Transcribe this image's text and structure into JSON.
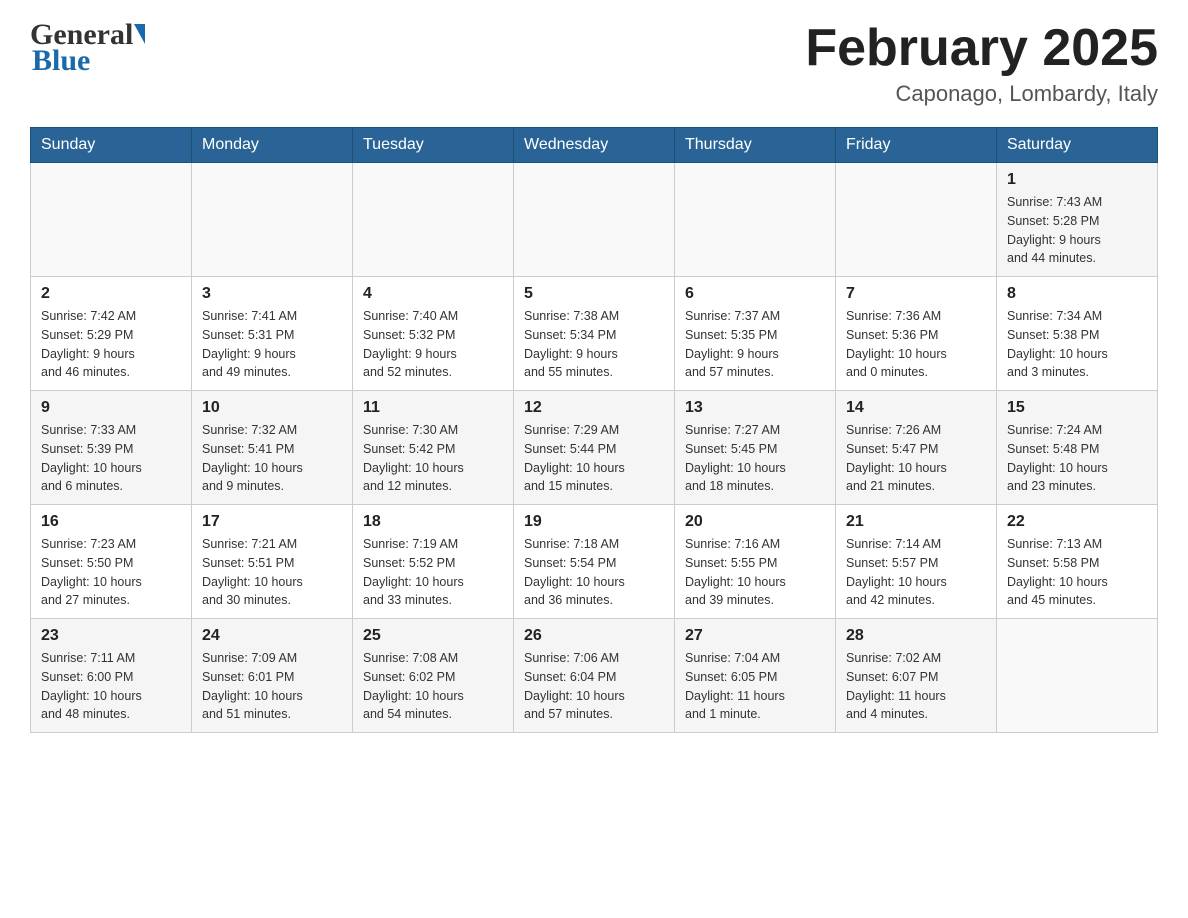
{
  "header": {
    "logo_general": "General",
    "logo_blue": "Blue",
    "month_title": "February 2025",
    "location": "Caponago, Lombardy, Italy"
  },
  "days_of_week": [
    "Sunday",
    "Monday",
    "Tuesday",
    "Wednesday",
    "Thursday",
    "Friday",
    "Saturday"
  ],
  "weeks": [
    [
      {
        "day": "",
        "info": ""
      },
      {
        "day": "",
        "info": ""
      },
      {
        "day": "",
        "info": ""
      },
      {
        "day": "",
        "info": ""
      },
      {
        "day": "",
        "info": ""
      },
      {
        "day": "",
        "info": ""
      },
      {
        "day": "1",
        "info": "Sunrise: 7:43 AM\nSunset: 5:28 PM\nDaylight: 9 hours\nand 44 minutes."
      }
    ],
    [
      {
        "day": "2",
        "info": "Sunrise: 7:42 AM\nSunset: 5:29 PM\nDaylight: 9 hours\nand 46 minutes."
      },
      {
        "day": "3",
        "info": "Sunrise: 7:41 AM\nSunset: 5:31 PM\nDaylight: 9 hours\nand 49 minutes."
      },
      {
        "day": "4",
        "info": "Sunrise: 7:40 AM\nSunset: 5:32 PM\nDaylight: 9 hours\nand 52 minutes."
      },
      {
        "day": "5",
        "info": "Sunrise: 7:38 AM\nSunset: 5:34 PM\nDaylight: 9 hours\nand 55 minutes."
      },
      {
        "day": "6",
        "info": "Sunrise: 7:37 AM\nSunset: 5:35 PM\nDaylight: 9 hours\nand 57 minutes."
      },
      {
        "day": "7",
        "info": "Sunrise: 7:36 AM\nSunset: 5:36 PM\nDaylight: 10 hours\nand 0 minutes."
      },
      {
        "day": "8",
        "info": "Sunrise: 7:34 AM\nSunset: 5:38 PM\nDaylight: 10 hours\nand 3 minutes."
      }
    ],
    [
      {
        "day": "9",
        "info": "Sunrise: 7:33 AM\nSunset: 5:39 PM\nDaylight: 10 hours\nand 6 minutes."
      },
      {
        "day": "10",
        "info": "Sunrise: 7:32 AM\nSunset: 5:41 PM\nDaylight: 10 hours\nand 9 minutes."
      },
      {
        "day": "11",
        "info": "Sunrise: 7:30 AM\nSunset: 5:42 PM\nDaylight: 10 hours\nand 12 minutes."
      },
      {
        "day": "12",
        "info": "Sunrise: 7:29 AM\nSunset: 5:44 PM\nDaylight: 10 hours\nand 15 minutes."
      },
      {
        "day": "13",
        "info": "Sunrise: 7:27 AM\nSunset: 5:45 PM\nDaylight: 10 hours\nand 18 minutes."
      },
      {
        "day": "14",
        "info": "Sunrise: 7:26 AM\nSunset: 5:47 PM\nDaylight: 10 hours\nand 21 minutes."
      },
      {
        "day": "15",
        "info": "Sunrise: 7:24 AM\nSunset: 5:48 PM\nDaylight: 10 hours\nand 23 minutes."
      }
    ],
    [
      {
        "day": "16",
        "info": "Sunrise: 7:23 AM\nSunset: 5:50 PM\nDaylight: 10 hours\nand 27 minutes."
      },
      {
        "day": "17",
        "info": "Sunrise: 7:21 AM\nSunset: 5:51 PM\nDaylight: 10 hours\nand 30 minutes."
      },
      {
        "day": "18",
        "info": "Sunrise: 7:19 AM\nSunset: 5:52 PM\nDaylight: 10 hours\nand 33 minutes."
      },
      {
        "day": "19",
        "info": "Sunrise: 7:18 AM\nSunset: 5:54 PM\nDaylight: 10 hours\nand 36 minutes."
      },
      {
        "day": "20",
        "info": "Sunrise: 7:16 AM\nSunset: 5:55 PM\nDaylight: 10 hours\nand 39 minutes."
      },
      {
        "day": "21",
        "info": "Sunrise: 7:14 AM\nSunset: 5:57 PM\nDaylight: 10 hours\nand 42 minutes."
      },
      {
        "day": "22",
        "info": "Sunrise: 7:13 AM\nSunset: 5:58 PM\nDaylight: 10 hours\nand 45 minutes."
      }
    ],
    [
      {
        "day": "23",
        "info": "Sunrise: 7:11 AM\nSunset: 6:00 PM\nDaylight: 10 hours\nand 48 minutes."
      },
      {
        "day": "24",
        "info": "Sunrise: 7:09 AM\nSunset: 6:01 PM\nDaylight: 10 hours\nand 51 minutes."
      },
      {
        "day": "25",
        "info": "Sunrise: 7:08 AM\nSunset: 6:02 PM\nDaylight: 10 hours\nand 54 minutes."
      },
      {
        "day": "26",
        "info": "Sunrise: 7:06 AM\nSunset: 6:04 PM\nDaylight: 10 hours\nand 57 minutes."
      },
      {
        "day": "27",
        "info": "Sunrise: 7:04 AM\nSunset: 6:05 PM\nDaylight: 11 hours\nand 1 minute."
      },
      {
        "day": "28",
        "info": "Sunrise: 7:02 AM\nSunset: 6:07 PM\nDaylight: 11 hours\nand 4 minutes."
      },
      {
        "day": "",
        "info": ""
      }
    ]
  ]
}
